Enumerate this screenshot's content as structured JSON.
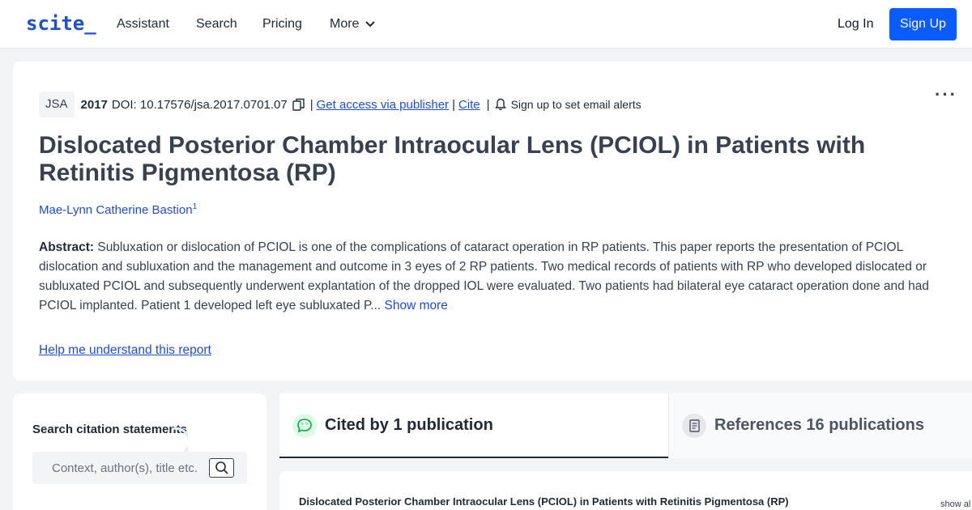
{
  "nav": {
    "logo": "scite_",
    "links": [
      "Assistant",
      "Search",
      "Pricing",
      "More"
    ],
    "login": "Log In",
    "signup": "Sign Up"
  },
  "paper": {
    "journal": "JSA",
    "year": "2017",
    "doi": "DOI: 10.17576/jsa.2017.0701.07",
    "publisher_link": "Get access via publisher",
    "cite_link": "Cite",
    "alerts": "Sign up to set email alerts",
    "title": "Dislocated Posterior Chamber Intraocular Lens (PCIOL) in Patients with Retinitis Pigmentosa (RP)",
    "author": "Mae-Lynn Catherine Bastion",
    "author_sup": "1",
    "abstract_label": "Abstract:",
    "abstract_text": " Subluxation or dislocation of PCIOL is one of the complications of cataract operation in RP patients. This paper reports the presentation of PCIOL dislocation and subluxation and the management and outcome in 3 eyes of 2 RP patients. Two medical records of patients with RP who developed dislocated or subluxated PCIOL and subsequently underwent explantation of the dropped IOL were evaluated. Two patients had bilateral eye cataract operation done and had PCIOL implanted. Patient 1 developed left eye subluxated P...",
    "show_more": "Show more",
    "help_link": "Help me understand this report"
  },
  "search": {
    "label": "Search citation statements",
    "placeholder": "Context, author(s), title etc."
  },
  "tabs": {
    "cited": "Cited by 1 publication",
    "references": "References 16 publications"
  },
  "citation": {
    "title": "Dislocated Posterior Chamber Intraocular Lens (PCIOL) in Patients with Retinitis Pigmentosa (RP)",
    "show_all": "show al"
  },
  "colors": {
    "accent": "#0a5cff",
    "link": "#1d4ed8",
    "cited_icon": "#22c55e"
  }
}
